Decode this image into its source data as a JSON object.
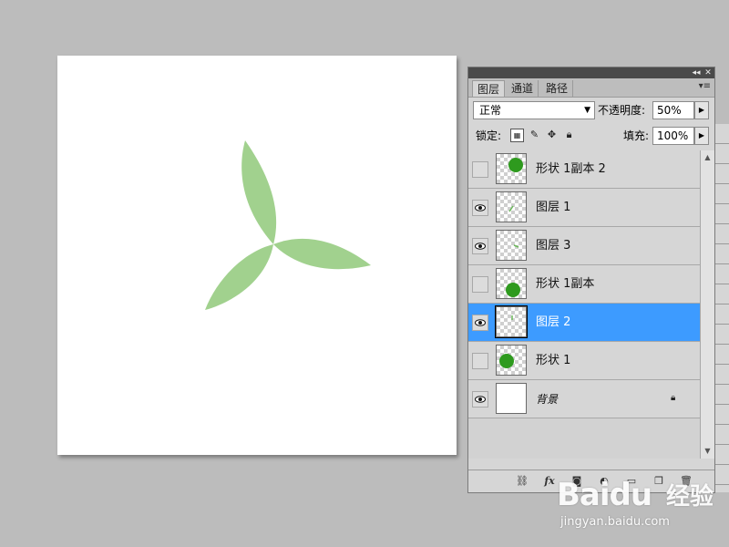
{
  "colors": {
    "workspace": "#bcbcbc",
    "leaf": "#a1d18e",
    "shape_green": "#2e9a1e",
    "selected_row": "#3d9bff"
  },
  "panel": {
    "tabs": [
      {
        "label": "图层",
        "active": true
      },
      {
        "label": "通道",
        "active": false
      },
      {
        "label": "路径",
        "active": false
      }
    ],
    "blend_mode": "正常",
    "opacity_label": "不透明度:",
    "opacity_value": "50%",
    "lock_label": "锁定:",
    "fill_label": "填充:",
    "fill_value": "100%"
  },
  "layers": [
    {
      "name": "形状 1副本 2",
      "visible": false,
      "selected": false,
      "thumb": "circle-top-right"
    },
    {
      "name": "图层 1",
      "visible": true,
      "selected": false,
      "thumb": "small-stroke"
    },
    {
      "name": "图层 3",
      "visible": true,
      "selected": false,
      "thumb": "small-dash"
    },
    {
      "name": "形状 1副本",
      "visible": false,
      "selected": false,
      "thumb": "circle-bottom"
    },
    {
      "name": "图层 2",
      "visible": true,
      "selected": true,
      "thumb": "small-tick"
    },
    {
      "name": "形状 1",
      "visible": false,
      "selected": false,
      "thumb": "circle-left"
    },
    {
      "name": "背景",
      "visible": true,
      "selected": false,
      "thumb": "white",
      "locked": true
    }
  ],
  "watermark": {
    "logo": "Baidu",
    "cn": "经验",
    "url": "jingyan.baidu.com"
  }
}
